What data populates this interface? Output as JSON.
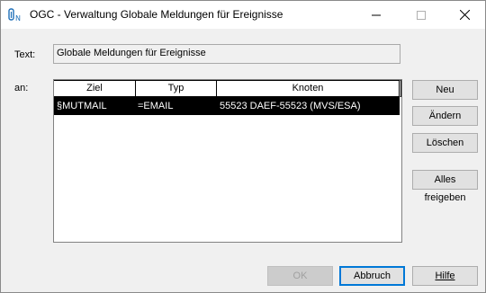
{
  "window": {
    "title": "OGC - Verwaltung Globale Meldungen für Ereignisse"
  },
  "form": {
    "text_label": "Text:",
    "text_value": "Globale Meldungen für Ereignisse",
    "an_label": "an:"
  },
  "list": {
    "columns": [
      "Ziel",
      "Typ",
      "Knoten"
    ],
    "rows": [
      {
        "ziel": "§MUTMAIL",
        "typ": "=EMAIL",
        "knoten": "55523  DAEF-55523 (MVS/ESA)",
        "selected": true
      }
    ]
  },
  "side_buttons": {
    "neu": "Neu",
    "aendern": "Ändern",
    "loeschen": "Löschen",
    "alles_freigeben": "Alles freigeben"
  },
  "bottom_buttons": {
    "ok": "OK",
    "abbruch": "Abbruch",
    "hilfe": "Hilfe"
  },
  "icons": {
    "app": "app-icon",
    "minimize": "minimize-icon",
    "maximize": "maximize-icon",
    "close": "close-icon"
  },
  "colors": {
    "selection_bg": "#000000",
    "selection_fg": "#ffffff",
    "default_button_border": "#0078d7"
  }
}
